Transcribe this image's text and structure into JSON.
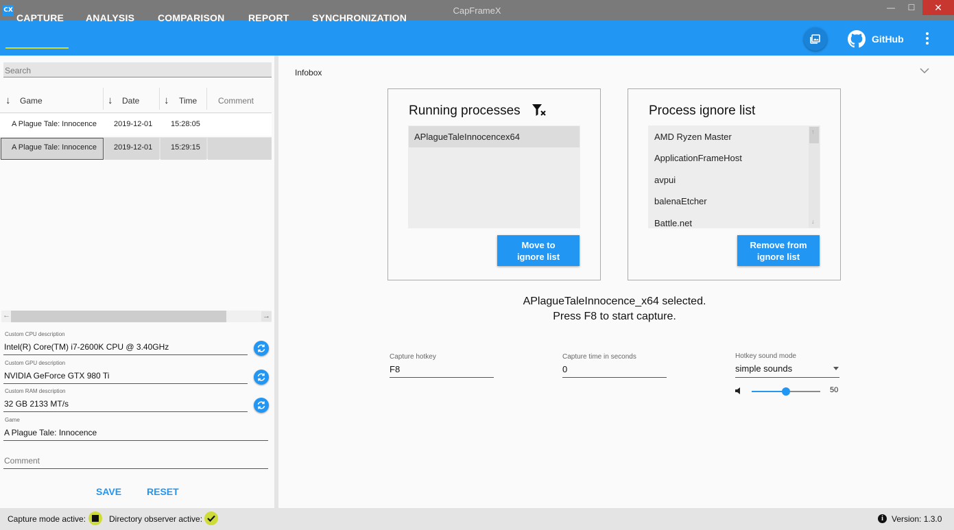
{
  "window": {
    "title": "CapFrameX",
    "icon_text": "CX",
    "min_glyph": "—",
    "max_glyph": "☐",
    "close_glyph": "✕"
  },
  "nav": {
    "tabs": [
      "CAPTURE",
      "ANALYSIS",
      "COMPARISON",
      "REPORT",
      "SYNCHRONIZATION"
    ],
    "github_label": "GitHub"
  },
  "left": {
    "search_placeholder": "Search",
    "columns": [
      "Game",
      "Date",
      "Time",
      "Comment"
    ],
    "sort_arrow": "↓",
    "rows": [
      {
        "game": "A Plague Tale: Innocence",
        "date": "2019-12-01",
        "time": "15:28:05",
        "comment": ""
      },
      {
        "game": "A Plague Tale: Innocence",
        "date": "2019-12-01",
        "time": "15:29:15",
        "comment": ""
      }
    ],
    "scroll_left": "←",
    "scroll_right": "→",
    "fields": {
      "cpu_label": "Custom CPU description",
      "cpu_value": "Intel(R) Core(TM) i7-2600K CPU @ 3.40GHz",
      "gpu_label": "Custom GPU description",
      "gpu_value": "NVIDIA GeForce GTX 980 Ti",
      "ram_label": "Custom RAM description",
      "ram_value": "32 GB 2133 MT/s",
      "game_label": "Game",
      "game_value": "A Plague Tale: Innocence",
      "comment_placeholder": "Comment"
    },
    "save_label": "SAVE",
    "reset_label": "RESET"
  },
  "right": {
    "infobox_label": "Infobox",
    "running": {
      "title": "Running processes",
      "items": [
        "APlagueTaleInnocencex64"
      ],
      "button": "Move to\nignore list"
    },
    "ignore": {
      "title": "Process ignore list",
      "items": [
        "AMD Ryzen Master",
        "ApplicationFrameHost",
        "avpui",
        "balenaEtcher",
        "Battle.net"
      ],
      "button": "Remove from\nignore list",
      "scroll_up": "↑",
      "scroll_down": "↓"
    },
    "message_line1": "APlagueTaleInnocence_x64 selected.",
    "message_line2": "Press F8 to start capture.",
    "hotkey_label": "Capture hotkey",
    "hotkey_value": "F8",
    "capture_time_label": "Capture time in seconds",
    "capture_time_value": "0",
    "sound_mode_label": "Hotkey sound mode",
    "sound_mode_value": "simple sounds",
    "volume": 50,
    "volume_text": "50"
  },
  "status": {
    "capture_mode": "Capture mode active:",
    "directory_observer": "Directory observer active:",
    "version": "Version: 1.3.0",
    "info_glyph": "i"
  },
  "colors": {
    "accent": "#2196f3",
    "indicator": "#cddc39"
  }
}
